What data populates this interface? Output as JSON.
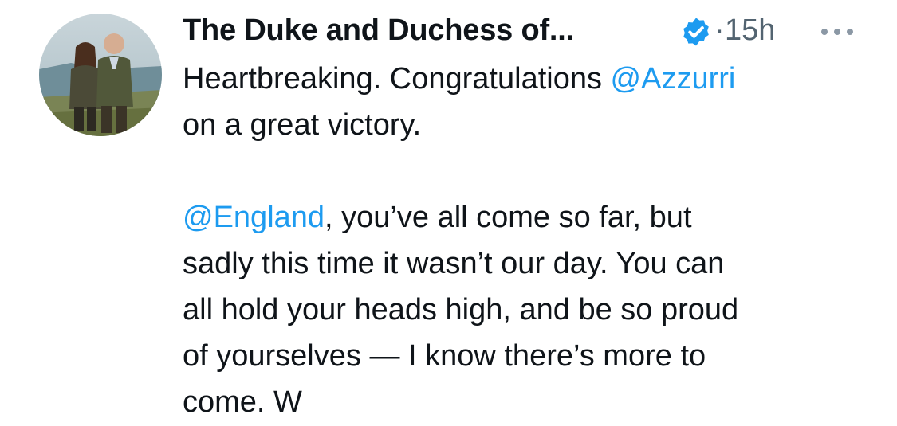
{
  "author": {
    "display_name": "The Duke and Duchess of...",
    "verified": true,
    "verified_icon": "verified-badge-icon",
    "dot": "·",
    "time_ago": "15h",
    "avatar_icon": "profile-photo"
  },
  "colors": {
    "text": "#0f1419",
    "secondary": "#536471",
    "link": "#1d9bf0",
    "badge": "#1d9bf0"
  },
  "tweet": {
    "line1_pre": "Heartbreaking. Congratulations ",
    "line1_mention": "@Azzurri",
    "line2": "on a great victory.",
    "para2_mention": "@England",
    "para2_line1_rest": ", you’ve all come so far, but",
    "para2_line2": "sadly this time it wasn’t our day.  You can",
    "para2_line3": "all hold your heads high, and be so proud",
    "para2_line4": "of yourselves — I know there’s more to",
    "para2_line5": "come. W"
  }
}
